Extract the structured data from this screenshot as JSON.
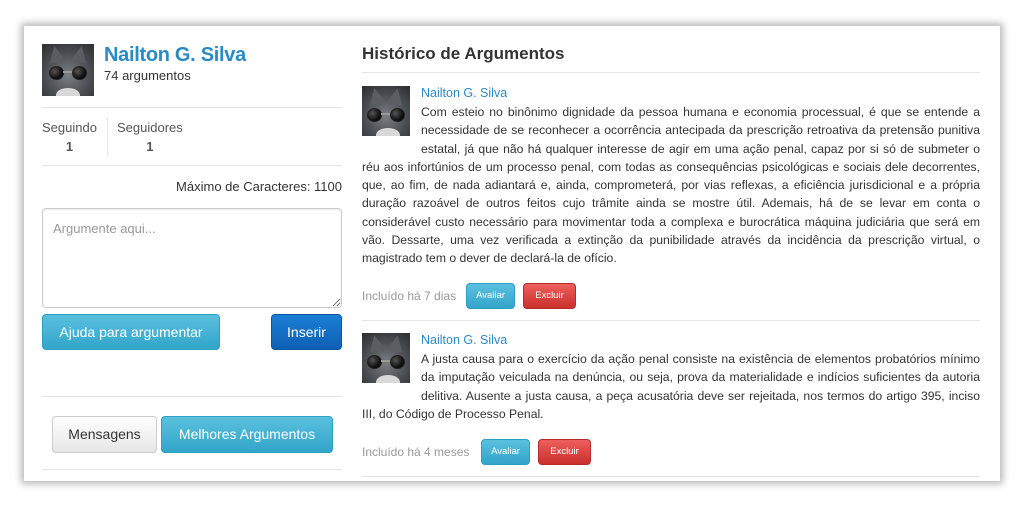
{
  "profile": {
    "name": "Nailton G. Silva",
    "argument_count": "74 argumentos",
    "avatar_icon": "cat-with-sunglasses-avatar"
  },
  "stats": {
    "following_label": "Seguindo",
    "following_value": "1",
    "followers_label": "Seguidores",
    "followers_value": "1"
  },
  "composer": {
    "max_chars_label": "Máximo de Caracteres: 1100",
    "placeholder": "Argumente aqui...",
    "help_button": "Ajuda para argumentar",
    "insert_button": "Inserir"
  },
  "footer_nav": {
    "messages_button": "Mensagens",
    "best_arguments_button": "Melhores Argumentos"
  },
  "history": {
    "title": "Histórico de Argumentos",
    "posts": [
      {
        "author": "Nailton G. Silva",
        "text": "Com esteio no binônimo dignidade da pessoa humana e economia processual, é que se entende a necessidade de se reconhecer a ocorrência antecipada da prescrição retroativa da pretensão punitiva estatal, já que não há qualquer interesse de agir em uma ação penal, capaz por si só de submeter o réu aos infortúnios de um processo penal, com todas as consequências psicológicas e sociais dele decorrentes, que, ao fim, de nada adiantará e, ainda, comprometerá, por vias reflexas, a eficiência jurisdicional e a própria duração razoável de outros feitos cujo trâmite ainda se mostre útil. Ademais, há de se levar em conta o considerável custo necessário para movimentar toda a complexa e burocrática máquina judiciária que será em vão. Dessarte, uma vez verificada a extinção da punibilidade através da incidência da prescrição virtual, o magistrado tem o dever de declará-la de ofício.",
        "included": "Incluído há 7 dias",
        "rate_button": "Avaliar",
        "delete_button": "Excluir"
      },
      {
        "author": "Nailton G. Silva",
        "text": "A justa causa para o exercício da ação penal consiste na existência de elementos probatórios mínimo da imputação veiculada na denúncia, ou seja, prova da materialidade e indícios suficientes da autoria delitiva. Ausente a justa causa, a peça acusatória deve ser rejeitada, nos termos do artigo 395, inciso III, do Código de Processo Penal.",
        "included": "Incluído há 4 meses",
        "rate_button": "Avaliar",
        "delete_button": "Excluir"
      }
    ]
  },
  "colors": {
    "link": "#2a8ac6",
    "info": "#31a5c9",
    "primary": "#0d5fb4",
    "danger": "#c9302c"
  }
}
